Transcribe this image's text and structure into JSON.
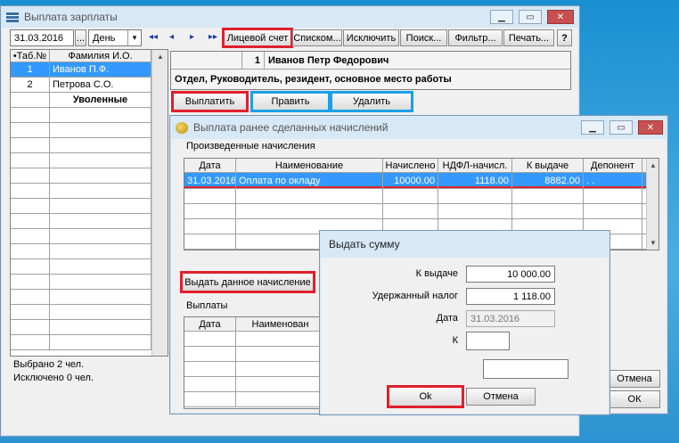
{
  "main": {
    "title": "Выплата зарплаты",
    "date": "31.03.2016",
    "period": "День",
    "nav": [
      "◂◂",
      "◂",
      "▸",
      "▸▸"
    ],
    "toolbar": [
      "Лицевой счет",
      "Списком...",
      "Исключить",
      "Поиск...",
      "Фильтр...",
      "Печать...",
      "?"
    ],
    "list_headers": [
      "•Таб.№",
      "Фамилия И.О."
    ],
    "list_rows": [
      {
        "num": "1",
        "name": "Иванов П.Ф."
      },
      {
        "num": "2",
        "name": "Петрова С.О."
      },
      {
        "num": "",
        "name": "Уволенные"
      }
    ],
    "selected_info": "Выбрано 2 чел.",
    "excluded_info": "Исключено 0 чел.",
    "employee_num": "1",
    "employee_name": "Иванов Петр Федорович",
    "employee_details": "Отдел, Руководитель, резидент, основное место работы",
    "pay_btn": "Выплатить",
    "edit_btn": "Править",
    "delete_btn": "Удалить"
  },
  "prev": {
    "title": "Выплата ранее сделанных начислений",
    "accruals_label": "Произведенные начисления",
    "headers": [
      "Дата",
      "Наименование",
      "Начислено",
      "НДФЛ-начисл.",
      "К выдаче",
      "Депонент"
    ],
    "rows": [
      {
        "date": "31.03.2016",
        "name": "Оплата по окладу",
        "accrued": "10000.00",
        "tax": "1118.00",
        "payout": "8882.00",
        "deposit": ". ."
      }
    ],
    "pay_this_btn": "Выдать данное начисление",
    "payments_label": "Выплаты",
    "pay_headers": [
      "Дата",
      "Наименован"
    ],
    "cancel_btn": "Отмена",
    "ok_btn": "ОК"
  },
  "dialog": {
    "title": "Выдать сумму",
    "payout_label": "К выдаче",
    "payout_value": "10 000.00",
    "tax_label": "Удержанный налог",
    "tax_value": "1 118.00",
    "date_label": "Дата",
    "date_value": "31.03.2016",
    "k_label": "К",
    "k_value": "",
    "extra_value": "",
    "ok_btn": "Ok",
    "cancel_btn": "Отмена"
  }
}
